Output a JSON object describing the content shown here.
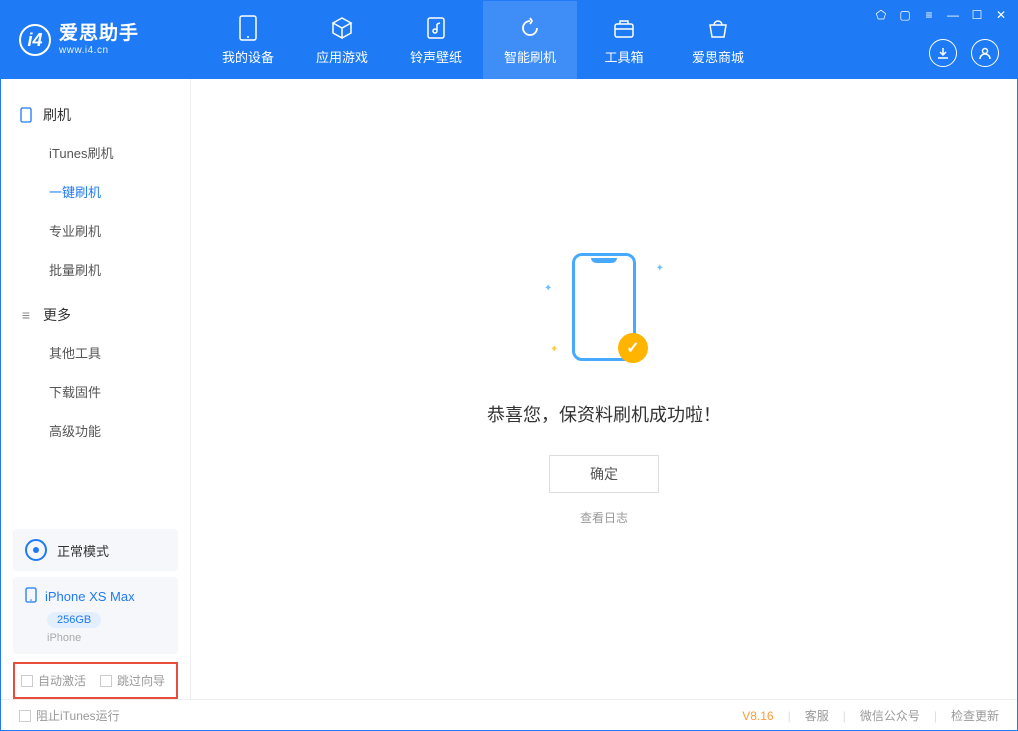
{
  "app": {
    "title": "爱思助手",
    "subtitle": "www.i4.cn"
  },
  "tabs": [
    {
      "label": "我的设备"
    },
    {
      "label": "应用游戏"
    },
    {
      "label": "铃声壁纸"
    },
    {
      "label": "智能刷机"
    },
    {
      "label": "工具箱"
    },
    {
      "label": "爱思商城"
    }
  ],
  "sidebar": {
    "group1": {
      "title": "刷机",
      "items": [
        "iTunes刷机",
        "一键刷机",
        "专业刷机",
        "批量刷机"
      ],
      "active": 1
    },
    "group2": {
      "title": "更多",
      "items": [
        "其他工具",
        "下载固件",
        "高级功能"
      ]
    }
  },
  "status": {
    "label": "正常模式"
  },
  "device": {
    "name": "iPhone XS Max",
    "storage": "256GB",
    "type": "iPhone"
  },
  "options": {
    "auto_activate": "自动激活",
    "skip_guide": "跳过向导"
  },
  "main": {
    "success_text": "恭喜您，保资料刷机成功啦！",
    "ok_button": "确定",
    "log_link": "查看日志"
  },
  "footer": {
    "block_itunes": "阻止iTunes运行",
    "version": "V8.16",
    "service": "客服",
    "wechat": "微信公众号",
    "update": "检查更新"
  }
}
